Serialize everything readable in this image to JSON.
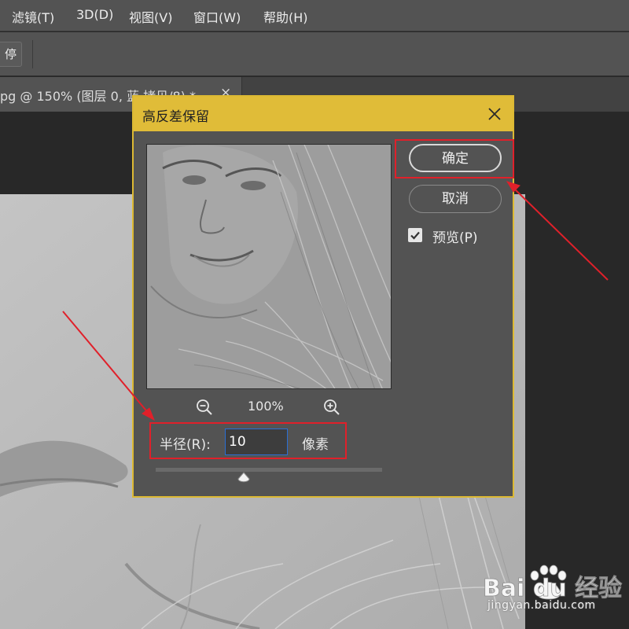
{
  "menubar": {
    "items": [
      "滤镜(T)",
      "3D(D)",
      "视图(V)",
      "窗口(W)",
      "帮助(H)"
    ]
  },
  "options_bar": {
    "partial_button_label": "停"
  },
  "document_tab": {
    "title": "pg @ 150% (图层 0, 蓝 拷贝/8) *",
    "close_symbol": "×"
  },
  "dialog": {
    "title": "高反差保留",
    "zoom_level": "100%",
    "radius_label": "半径(R):",
    "radius_value": "10",
    "radius_unit": "像素",
    "slider_value": 10,
    "buttons": {
      "ok": "确定",
      "cancel": "取消"
    },
    "preview_checkbox": {
      "label": "预览(P)",
      "checked": true
    }
  },
  "watermark": {
    "brand": "Bai du 经验",
    "url": "jingyan.baidu.com"
  },
  "colors": {
    "dialog_title_bar": "#e0bc38",
    "annotation_red": "#e0202a",
    "input_focus_border": "#2b6fd4"
  },
  "icons": [
    "close-icon",
    "zoom-out-icon",
    "zoom-in-icon",
    "checkmark-icon",
    "slider-thumb-icon",
    "baidu-paw-icon"
  ]
}
